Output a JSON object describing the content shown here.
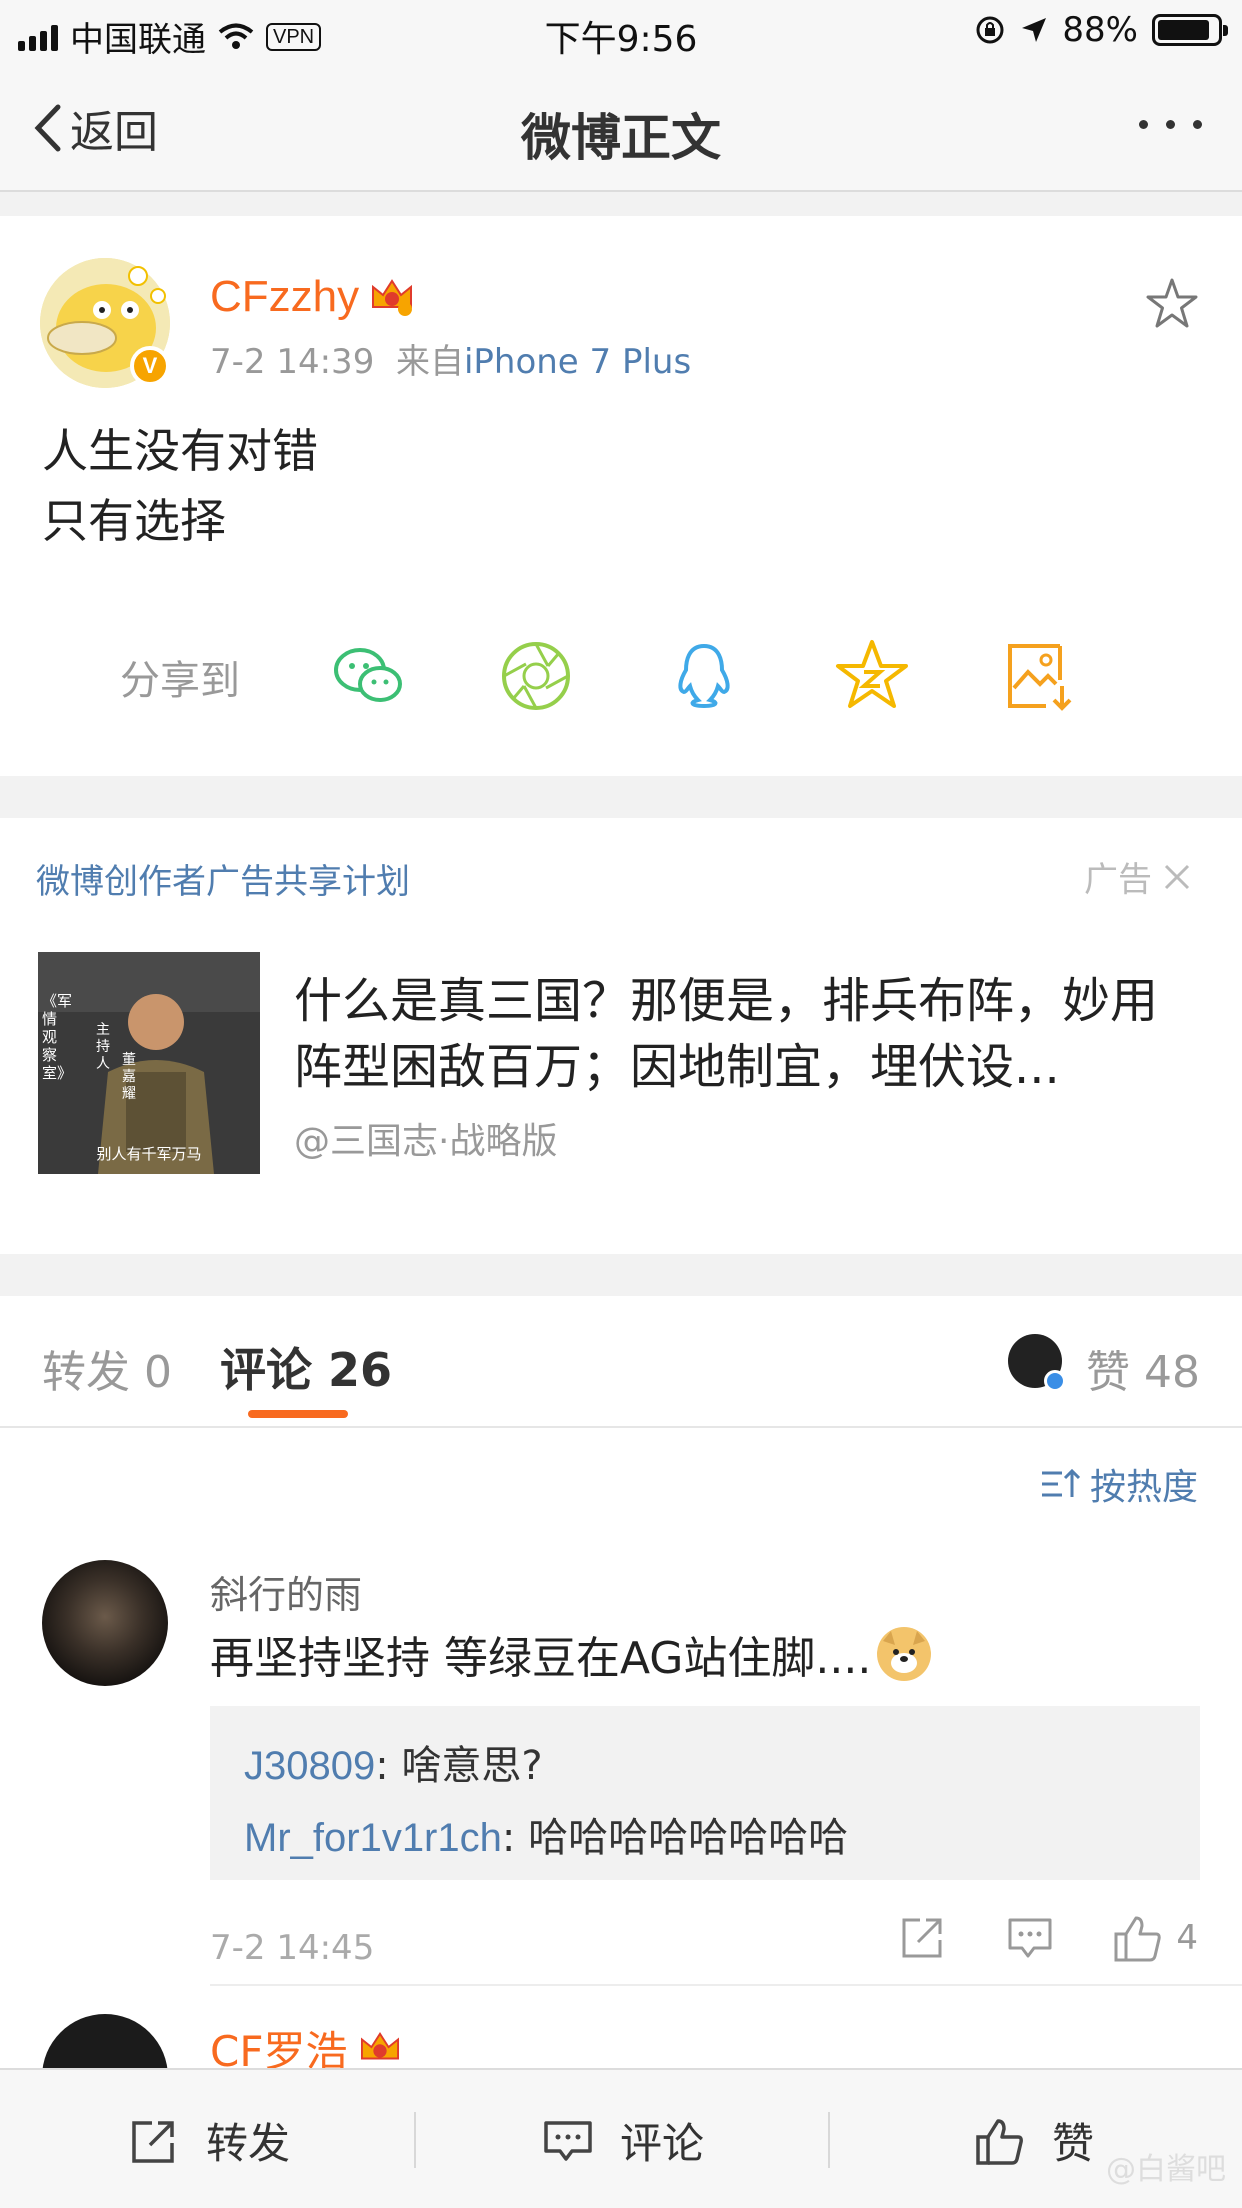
{
  "status_bar": {
    "carrier": "中国联通",
    "vpn": "VPN",
    "time": "下午9:56",
    "battery": "88%"
  },
  "nav": {
    "back": "返回",
    "title": "微博正文"
  },
  "post": {
    "username": "CFzzhy",
    "badge": "V",
    "date": "7-2 14:39",
    "from_label": "来自",
    "source": "iPhone 7 Plus",
    "lines": [
      "人生没有对错",
      "只有选择"
    ],
    "share_label": "分享到"
  },
  "ad": {
    "header": "微博创作者广告共享计划",
    "tag": "广告",
    "title": "什么是真三国？那便是，排兵布阵，妙用阵型困敌百万；因地制宜，埋伏设...",
    "author": "@三国志·战略版",
    "thumb_side": "《军情观察室》",
    "thumb_host": "主持人",
    "thumb_name": "董嘉耀",
    "thumb_caption": "别人有千军万马"
  },
  "tabs": {
    "repost": "转发 0",
    "comment": "评论 26",
    "like": "赞 48"
  },
  "comments": {
    "sort": "按热度",
    "items": [
      {
        "name": "斜行的雨",
        "text": "再坚持坚持  等绿豆在AG站住脚....",
        "replies": [
          {
            "user": "J30809",
            "text": ": 啥意思?"
          },
          {
            "user": "Mr_for1v1r1ch",
            "text": ": 哈哈哈哈哈哈哈哈"
          }
        ],
        "time": "7-2 14:45",
        "likes": "4"
      },
      {
        "name": "CF罗浩"
      }
    ]
  },
  "toolbar": {
    "repost": "转发",
    "comment": "评论",
    "like": "赞"
  },
  "watermark": "@白酱吧",
  "colors": {
    "accent": "#f86a1f",
    "link": "#507daf",
    "muted": "#999999"
  }
}
